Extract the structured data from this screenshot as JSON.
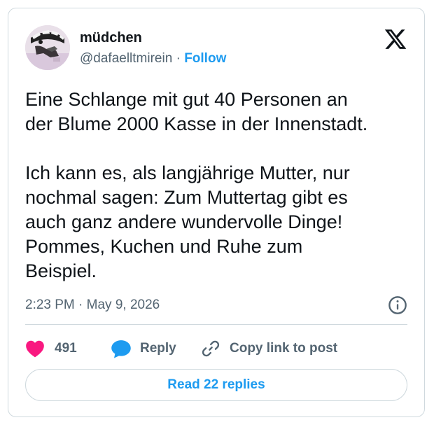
{
  "author": {
    "display_name": "müdchen",
    "handle": "@dafaelltmirein",
    "separator": "·",
    "follow_label": "Follow"
  },
  "tweet": {
    "text": "Eine Schlange mit gut 40 Personen an\nder Blume 2000 Kasse in der Innenstadt.\n\nIch kann es, als langjährige Mutter, nur\nnochmal sagen: Zum Muttertag gibt es\nauch ganz andere wundervolle Dinge!\nPommes, Kuchen und Ruhe zum\nBeispiel.",
    "timestamp": "2:23 PM · May 9, 2026"
  },
  "actions": {
    "likes_count": "491",
    "reply_label": "Reply",
    "copy_link_label": "Copy link to post"
  },
  "footer": {
    "read_replies_label": "Read 22 replies"
  },
  "icons": {
    "brand": "x-logo-icon",
    "info": "info-icon",
    "like": "heart-icon",
    "reply": "speech-bubble-icon",
    "copy": "link-icon"
  },
  "colors": {
    "accent": "#1d9bf0",
    "like": "#f91880",
    "text_primary": "#0f1419",
    "text_secondary": "#536471",
    "border": "#cfd9de"
  }
}
